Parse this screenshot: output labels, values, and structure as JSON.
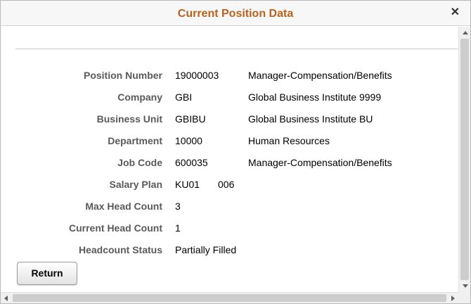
{
  "dialog": {
    "title": "Current Position Data",
    "close_glyph": "✕"
  },
  "fields": [
    {
      "label": "Position Number",
      "value": "19000003",
      "description": "Manager-Compensation/Benefits"
    },
    {
      "label": "Company",
      "value": "GBI",
      "description": "Global Business Institute 9999"
    },
    {
      "label": "Business Unit",
      "value": "GBIBU",
      "description": "Global Business Institute BU"
    },
    {
      "label": "Department",
      "value": "10000",
      "description": "Human Resources"
    },
    {
      "label": "Job Code",
      "value": "600035",
      "description": "Manager-Compensation/Benefits"
    },
    {
      "label": "Salary Plan",
      "value": "KU01",
      "value2": "006"
    },
    {
      "label": "Max Head Count",
      "value": "3"
    },
    {
      "label": "Current Head Count",
      "value": "1"
    },
    {
      "label": "Headcount Status",
      "value": "Partially Filled"
    }
  ],
  "buttons": {
    "return_label": "Return"
  },
  "colors": {
    "title": "#b8621b",
    "label": "#5a5a5a"
  }
}
